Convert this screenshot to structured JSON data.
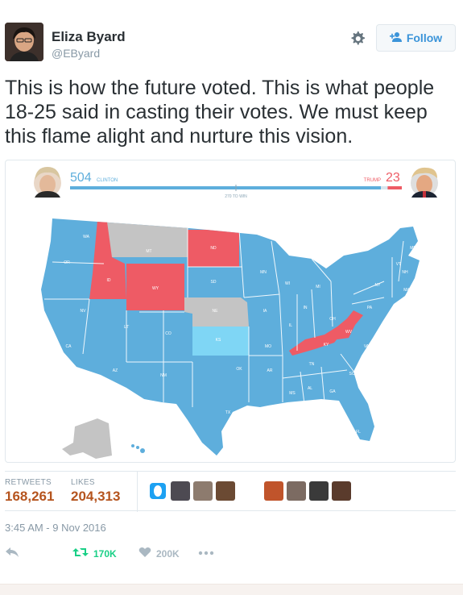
{
  "user": {
    "display_name": "Eliza Byard",
    "handle": "@EByard",
    "follow_label": "Follow"
  },
  "tweet": {
    "text": "This is how the future voted. This is what people 18-25 said in casting their votes. We must keep this flame alight and nurture this vision."
  },
  "map_image": {
    "clinton_count": "504",
    "clinton_label": "CLINTON",
    "trump_label": "TRUMP",
    "trump_count": "23",
    "threshold_label": "270 TO WIN",
    "clinton_share": 0.9368,
    "trump_share": 0.0428,
    "colors": {
      "clinton": "#5eaedc",
      "trump": "#ee5b65",
      "undecided": "#c4c4c4",
      "tossup": "#7fd6f5"
    },
    "state_labels": {
      "clinton": [
        "WA",
        "OR",
        "CA",
        "NV",
        "UT",
        "AZ",
        "CO",
        "NM",
        "TX",
        "OK",
        "SD",
        "MN",
        "IA",
        "MO",
        "AR",
        "LA",
        "WI",
        "IL",
        "MI",
        "IN",
        "OH",
        "TN",
        "MS",
        "AL",
        "GA",
        "FL",
        "SC",
        "NC",
        "VA",
        "PA",
        "NY",
        "ME",
        "NH",
        "VT",
        "MA",
        "CT",
        "RI",
        "NJ",
        "DE",
        "MD",
        "HI"
      ],
      "trump": [
        "ID",
        "WY",
        "ND",
        "KY",
        "WV"
      ],
      "undecided": [
        "MT",
        "NE",
        "AK"
      ],
      "tossup": [
        "KS"
      ]
    }
  },
  "stats": {
    "retweets_label": "RETWEETS",
    "retweets_value": "168,261",
    "likes_label": "LIKES",
    "likes_value": "204,313"
  },
  "timestamp": "3:45 AM - 9 Nov 2016",
  "actions": {
    "retweet_count": "170K",
    "like_count": "200K"
  }
}
